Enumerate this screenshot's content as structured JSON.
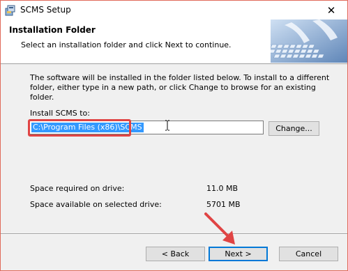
{
  "window": {
    "title": "SCMS Setup",
    "close_glyph": "✕"
  },
  "header": {
    "title": "Installation Folder",
    "subtitle": "Select an installation folder and click Next to continue."
  },
  "body": {
    "description": "The software will be installed in the folder listed below. To install to a different folder, either type in a new path, or click Change to browse for an existing folder.",
    "install_label": "Install SCMS to:",
    "install_path": "C:\\Program Files (x86)\\SCMS",
    "change_label": "Change...",
    "space_required_label": "Space required on drive:",
    "space_required_value": "11.0 MB",
    "space_available_label": "Space available on selected drive:",
    "space_available_value": "5701 MB"
  },
  "footer": {
    "back_label": "< Back",
    "next_label": "Next >",
    "cancel_label": "Cancel"
  },
  "icons": {
    "app": "setup-app-icon",
    "banner": "keyboard-typing-image",
    "cursor": "text-cursor-icon",
    "annotation_arrow": "red-arrow-icon"
  },
  "colors": {
    "highlight_box": "#e04444",
    "selection": "#3399ff",
    "default_button_border": "#0078d7"
  }
}
